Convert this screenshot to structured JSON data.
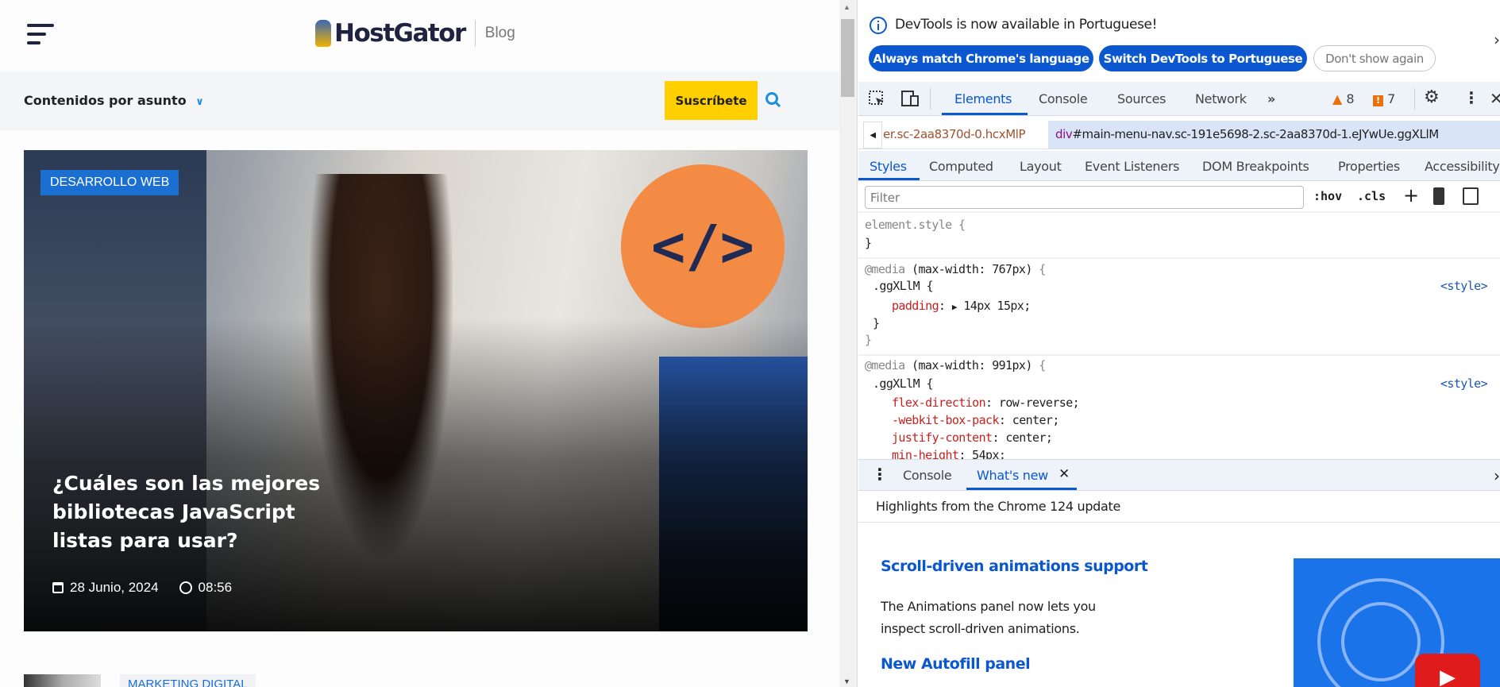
{
  "page": {
    "logo_text": "HostGator",
    "blog_label": "Blog",
    "topics_label": "Contenidos por asunto",
    "subscribe_label": "Suscríbete",
    "hero": {
      "category": "DESARROLLO WEB",
      "title": "¿Cuáles son las mejores bibliotecas JavaScript listas para usar?",
      "date": "28 Junio, 2024",
      "time": "08:56"
    },
    "next_item_category": "MARKETING DIGITAL",
    "colors": {
      "brand": "#1f2340",
      "accent": "#1a6fd1",
      "subscribe": "#ffcf00"
    }
  },
  "devtools": {
    "infobar": {
      "message": "DevTools is now available in Portuguese!",
      "btn_match": "Always match Chrome's language",
      "btn_switch": "Switch DevTools to Portuguese",
      "btn_dismiss": "Don't show again"
    },
    "tabs": [
      "Elements",
      "Console",
      "Sources",
      "Network"
    ],
    "warnings": "8",
    "issues": "7",
    "breadcrumb": {
      "prev": "er.sc-2aa8370d-0.hcxMlP",
      "current_tag": "div",
      "current_rest": "#main-menu-nav.sc-191e5698-2.sc-2aa8370d-1.eJYwUe.ggXLlM"
    },
    "subtabs": [
      "Styles",
      "Computed",
      "Layout",
      "Event Listeners",
      "DOM Breakpoints",
      "Properties",
      "Accessibility"
    ],
    "filter_placeholder": "Filter",
    "hov": ":hov",
    "cls": ".cls",
    "rules": {
      "element_style": "element.style {",
      "close": "}",
      "media1_at": "@media",
      "media1_q": " (max-width: 767px) ",
      "brace_open": "{",
      "selector": ".ggXLlM {",
      "source": "<style>",
      "padding_prop": "padding",
      "padding_val": "14px 15px;",
      "media2_q": " (max-width: 991px) ",
      "flex_prop": "flex-direction",
      "flex_val": " row-reverse;",
      "wbp_prop": "-webkit-box-pack",
      "wbp_val": " center;",
      "jc_prop": "justify-content",
      "jc_val": " center;",
      "mh_prop": "min-height",
      "mh_val": " 54px;"
    },
    "drawer": {
      "tabs": [
        "Console",
        "What's new"
      ],
      "highlights": "Highlights from the Chrome 124 update",
      "item1_title": "Scroll-driven animations support",
      "item1_body": "The Animations panel now lets you inspect scroll-driven animations.",
      "item2_title": "New Autofill panel"
    },
    "accent": "#0b57d0"
  }
}
